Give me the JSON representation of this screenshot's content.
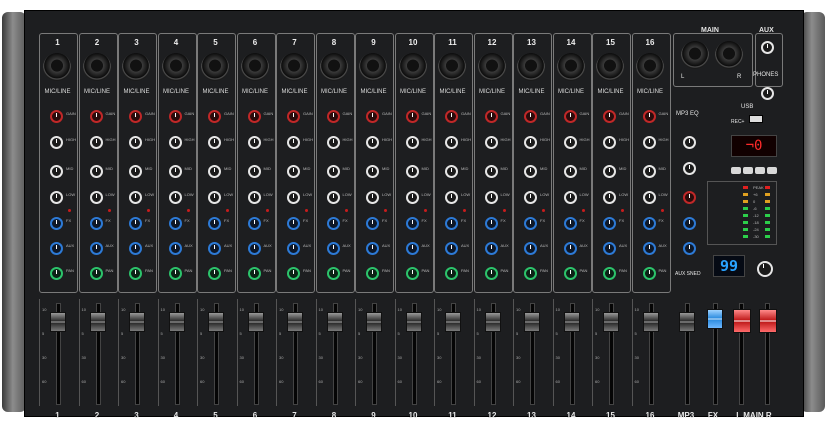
{
  "channels": [
    {
      "number": "1",
      "input_label": "MIC/LINE",
      "fader_label": "1"
    },
    {
      "number": "2",
      "input_label": "MIC/LINE",
      "fader_label": "2"
    },
    {
      "number": "3",
      "input_label": "MIC/LINE",
      "fader_label": "3"
    },
    {
      "number": "4",
      "input_label": "MIC/LINE",
      "fader_label": "4"
    },
    {
      "number": "5",
      "input_label": "MIC/LINE",
      "fader_label": "5"
    },
    {
      "number": "6",
      "input_label": "MIC/LINE",
      "fader_label": "6"
    },
    {
      "number": "7",
      "input_label": "MIC/LINE",
      "fader_label": "7"
    },
    {
      "number": "8",
      "input_label": "MIC/LINE",
      "fader_label": "8"
    },
    {
      "number": "9",
      "input_label": "MIC/LINE",
      "fader_label": "9"
    },
    {
      "number": "10",
      "input_label": "MIC/LINE",
      "fader_label": "10"
    },
    {
      "number": "11",
      "input_label": "MIC/LINE",
      "fader_label": "11"
    },
    {
      "number": "12",
      "input_label": "MIC/LINE",
      "fader_label": "12"
    },
    {
      "number": "13",
      "input_label": "MIC/LINE",
      "fader_label": "13"
    },
    {
      "number": "14",
      "input_label": "MIC/LINE",
      "fader_label": "14"
    },
    {
      "number": "15",
      "input_label": "MIC/LINE",
      "fader_label": "15"
    },
    {
      "number": "16",
      "input_label": "MIC/LINE",
      "fader_label": "16"
    }
  ],
  "knob_labels": {
    "gain": "GAIN",
    "high": "HIGH",
    "mid": "MID",
    "low": "LOW",
    "fx": "FX",
    "aux": "AUX",
    "pan": "PAN"
  },
  "master": {
    "main_label": "MAIN",
    "aux_label": "AUX",
    "phones_label": "PHONES",
    "left_label": "L",
    "right_label": "R",
    "mp3_eq_label": "MP3 EQ",
    "usb_label": "USB",
    "rec_label": "REC+",
    "mp3_display": "¬0",
    "fx_display": "99",
    "aux_send_label": "AUX SNED",
    "fader_labels": [
      "MP3",
      "FX",
      "L MAIN R"
    ],
    "meter_labels": [
      "PEAK",
      "+6",
      "0",
      "-6",
      "-12",
      "-18",
      "-24",
      "-30"
    ]
  },
  "fader_scale": [
    "10",
    "5",
    "0",
    "5",
    "10",
    "20",
    "30",
    "40",
    "50",
    "60",
    "70",
    "90"
  ],
  "colors": {
    "gain": "#c02828",
    "eq": "#e6e6e6",
    "aux": "#2d7ad6",
    "pan": "#2cc36b",
    "fx_fader": "#2e8de0",
    "main_fader": "#c01c1c",
    "display": "#29a3ff",
    "mp3_display": "#ff2a2a"
  }
}
